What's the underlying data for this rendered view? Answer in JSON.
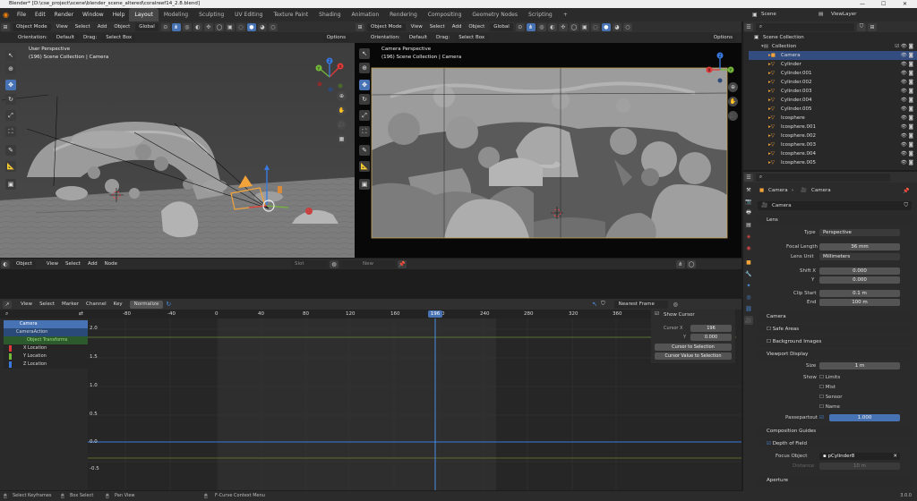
{
  "window": {
    "title": "Blender* [D:\\cse_project\\scene\\blender_scene_altered\\coralreef14_2.8.blend]",
    "controls": [
      "—",
      "☐",
      "✕"
    ]
  },
  "menu": {
    "items": [
      "File",
      "Edit",
      "Render",
      "Window",
      "Help"
    ],
    "tabs": [
      "Layout",
      "Modeling",
      "Sculpting",
      "UV Editing",
      "Texture Paint",
      "Shading",
      "Animation",
      "Rendering",
      "Compositing",
      "Geometry Nodes",
      "Scripting"
    ],
    "active_tab": "Layout",
    "add": "+",
    "scene": "Scene",
    "view_layer": "ViewLayer"
  },
  "viewport_left": {
    "mode": "Object Mode",
    "menus": [
      "View",
      "Select",
      "Add",
      "Object"
    ],
    "orientation_label": "Orientation:",
    "orientation": "Default",
    "drag_label": "Drag:",
    "drag": "Select Box",
    "transform": "Global",
    "options": "Options",
    "title": "User Perspective",
    "subtitle": "(196) Scene Collection | Camera"
  },
  "viewport_right": {
    "mode": "Object Mode",
    "menus": [
      "View",
      "Select",
      "Add",
      "Object"
    ],
    "orientation_label": "Orientation:",
    "orientation": "Default",
    "drag_label": "Drag:",
    "drag": "Select Box",
    "transform": "Global",
    "options": "Options",
    "title": "Camera Perspective",
    "subtitle": "(196) Scene Collection | Camera"
  },
  "node_header": {
    "mode": "Object",
    "menus": [
      "View",
      "Select",
      "Add",
      "Node"
    ],
    "slot": "Slot",
    "new": "New"
  },
  "gizmo": {
    "x": "X",
    "y": "Y",
    "z": "Z"
  },
  "graph": {
    "menus": [
      "View",
      "Select",
      "Marker",
      "Channel",
      "Key"
    ],
    "normalize": "Normalize",
    "snap": "Nearest Frame",
    "ruler": [
      "-80",
      "-40",
      "0",
      "40",
      "80",
      "120",
      "160",
      "200",
      "240",
      "280",
      "320",
      "360"
    ],
    "current_frame": "196",
    "y_labels": [
      "2.0",
      "1.5",
      "1.0",
      "0.5",
      "0.0",
      "-0.5"
    ],
    "channels": [
      {
        "label": "Camera",
        "color": "#4772b3"
      },
      {
        "label": "CameraAction",
        "color": "#2a4a7a"
      },
      {
        "label": "Object Transforms",
        "color": "#2d5a2d"
      },
      {
        "label": "X Location",
        "color": "#e03a3a"
      },
      {
        "label": "Y Location",
        "color": "#74b83a"
      },
      {
        "label": "Z Location",
        "color": "#3a7ae0"
      }
    ],
    "sidebar": {
      "show_cursor": "Show Cursor",
      "cursor_x_label": "Cursor X",
      "cursor_x": "196",
      "y_label": "Y",
      "y_value": "0.000",
      "cursor_to_selection": "Cursor to Selection",
      "cursor_value_to_selection": "Cursor Value to Selection"
    }
  },
  "outliner": {
    "root": "Scene Collection",
    "collection": "Collection",
    "items": [
      "Camera",
      "Cylinder",
      "Cylinder.001",
      "Cylinder.002",
      "Cylinder.003",
      "Cylinder.004",
      "Cylinder.005",
      "Icosphere",
      "Icosphere.001",
      "Icosphere.002",
      "Icosphere.003",
      "Icosphere.004",
      "Icosphere.005"
    ],
    "selected": "Camera"
  },
  "properties": {
    "breadcrumb_a": "Camera",
    "breadcrumb_b": "Camera",
    "data_name": "Camera",
    "lens_section": "Lens",
    "type_label": "Type",
    "type": "Perspective",
    "focal_label": "Focal Length",
    "focal": "36 mm",
    "unit_label": "Lens Unit",
    "unit": "Millimeters",
    "shiftx_label": "Shift X",
    "shiftx": "0.000",
    "shifty_label": "Y",
    "shifty": "0.000",
    "clipstart_label": "Clip Start",
    "clipstart": "0.1 m",
    "clipend_label": "End",
    "clipend": "100 m",
    "camera_section": "Camera",
    "safe_areas": "Safe Areas",
    "background_images": "Background Images",
    "viewport_display": "Viewport Display",
    "size_label": "Size",
    "size": "1 m",
    "show_label": "Show",
    "show_items": [
      "Limits",
      "Mist",
      "Sensor",
      "Name"
    ],
    "passepartout_label": "Passepartout",
    "passepartout": "1.000",
    "composition_guides": "Composition Guides",
    "dof": "Depth of Field",
    "focus_object_label": "Focus Object",
    "focus_object": "pCylinder8",
    "distance_label": "Distance",
    "distance": "10 m",
    "aperture": "Aperture"
  },
  "status": {
    "select_keyframes": "Select Keyframes",
    "box_select": "Box Select",
    "pan_view": "Pan View",
    "context": "F-Curve Context Menu",
    "version": "3.0.0"
  },
  "colors": {
    "accent": "#4772b3",
    "x_axis": "#e03a3a",
    "y_axis": "#74b83a",
    "z_axis": "#3a7ae0",
    "camera_orange": "#f2a33a"
  }
}
